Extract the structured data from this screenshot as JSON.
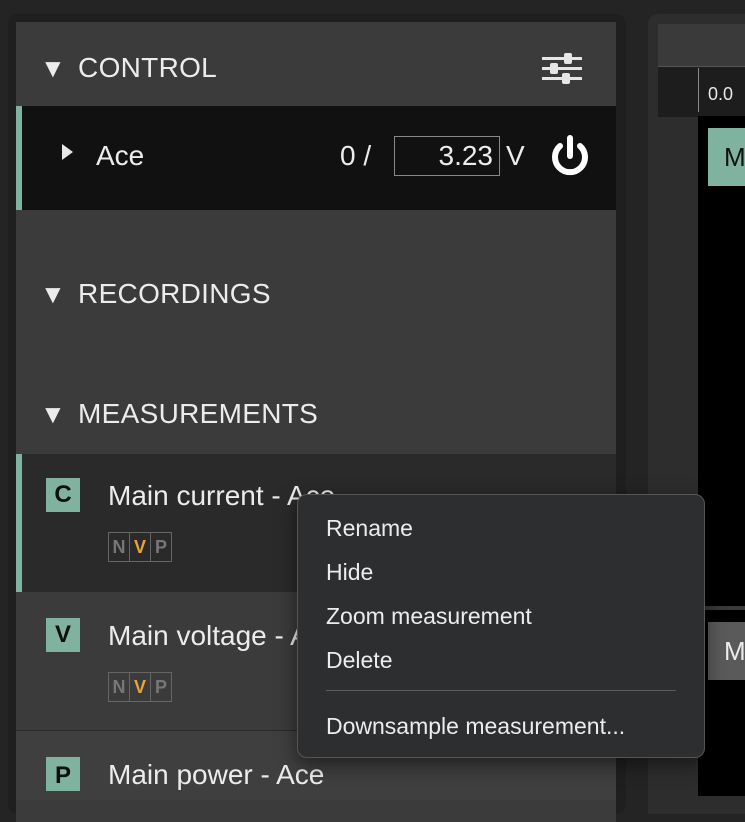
{
  "control": {
    "header": "CONTROL",
    "device_name": "Ace",
    "current_value": "0 /",
    "voltage_value": "3.23",
    "voltage_unit": "V"
  },
  "recordings": {
    "header": "RECORDINGS"
  },
  "measurements": {
    "header": "MEASUREMENTS",
    "items": [
      {
        "badge": "C",
        "name": "Main current - Ace",
        "nvp": [
          "N",
          "V",
          "P"
        ],
        "active": "V"
      },
      {
        "badge": "V",
        "name": "Main voltage - Ace",
        "nvp": [
          "N",
          "V",
          "P"
        ],
        "active": "V"
      },
      {
        "badge": "P",
        "name": "Main power - Ace"
      }
    ]
  },
  "right_panel": {
    "time_label": "0.0",
    "chip_top": "M",
    "chip_mid": "M"
  },
  "context_menu": {
    "items": [
      "Rename",
      "Hide",
      "Zoom measurement",
      "Delete"
    ],
    "extra_item": "Downsample measurement..."
  },
  "colors": {
    "accent": "#7fb3a0",
    "active_channel": "#e8a33a"
  }
}
